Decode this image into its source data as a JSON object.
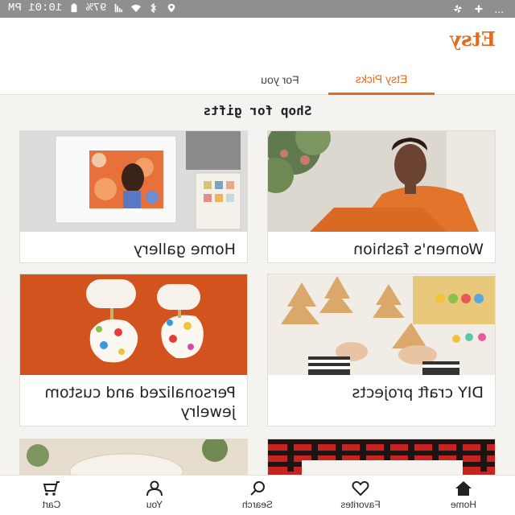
{
  "status_bar": {
    "time": "10:01 PM",
    "battery": "97%",
    "overflow": "...",
    "icons": [
      "signal-icon",
      "wifi-icon",
      "bluetooth-icon",
      "location-icon",
      "fan-icon",
      "battery-icon"
    ]
  },
  "app": {
    "brand": "Etsy"
  },
  "tabs": [
    {
      "label": "Etsy Picks",
      "active": true
    },
    {
      "label": "For you",
      "active": false
    }
  ],
  "section": {
    "title": "Shop for gifts"
  },
  "cards": [
    {
      "label": "Women's fashion"
    },
    {
      "label": "Home gallery"
    },
    {
      "label": "Personalized and custom jewelry"
    },
    {
      "label": "DIY craft projects"
    },
    {
      "label": ""
    },
    {
      "label": ""
    }
  ],
  "bottom_nav": [
    {
      "label": "Home",
      "icon": "home-icon"
    },
    {
      "label": "Favorites",
      "icon": "heart-icon"
    },
    {
      "label": "Search",
      "icon": "search-icon"
    },
    {
      "label": "You",
      "icon": "person-icon"
    },
    {
      "label": "Cart",
      "icon": "cart-icon"
    }
  ],
  "colors": {
    "accent": "#e66a1c",
    "status_bar": "#8f8f8f",
    "background": "#f4f3ef"
  }
}
